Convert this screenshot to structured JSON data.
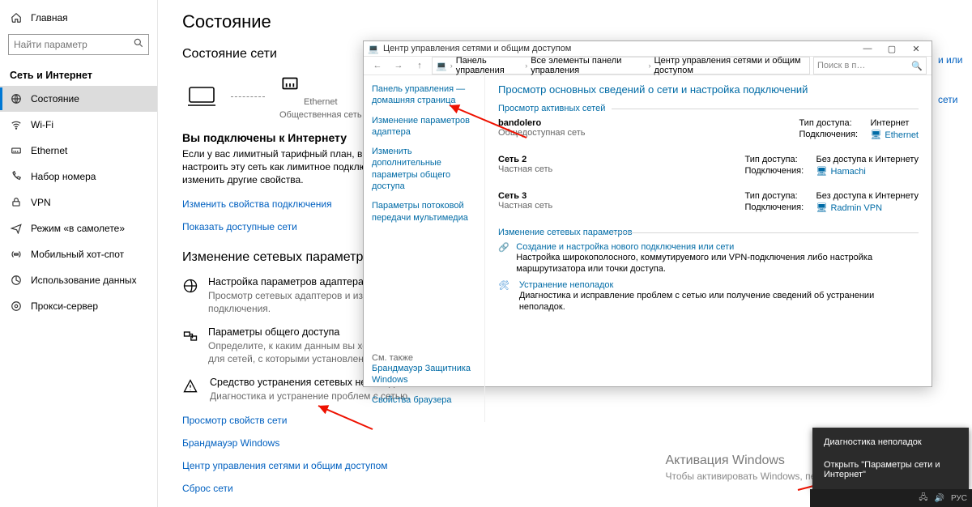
{
  "sidebar": {
    "home": "Главная",
    "search_placeholder": "Найти параметр",
    "group": "Сеть и Интернет",
    "items": [
      {
        "label": "Состояние"
      },
      {
        "label": "Wi-Fi"
      },
      {
        "label": "Ethernet"
      },
      {
        "label": "Набор номера"
      },
      {
        "label": "VPN"
      },
      {
        "label": "Режим «в самолете»"
      },
      {
        "label": "Мобильный хот-спот"
      },
      {
        "label": "Использование данных"
      },
      {
        "label": "Прокси-сервер"
      }
    ]
  },
  "content": {
    "title": "Состояние",
    "status_header": "Состояние сети",
    "diagram": {
      "adapter": "Ethernet",
      "network": "Общественная сеть"
    },
    "connected_title": "Вы подключены к Интернету",
    "connected_desc": "Если у вас лимитный тарифный план, вы можете настроить эту сеть как лимитное подключение или изменить другие свойства.",
    "link_change_props": "Изменить свойства подключения",
    "link_show_nets": "Показать доступные сети",
    "change_header": "Изменение сетевых параметров",
    "opts": [
      {
        "title": "Настройка параметров адаптера",
        "sub": "Просмотр сетевых адаптеров и изменение параметров подключения."
      },
      {
        "title": "Параметры общего доступа",
        "sub": "Определите, к каким данным вы хотите предоставить доступ для сетей, с которыми установлено соединение."
      },
      {
        "title": "Средство устранения сетевых неполадок",
        "sub": "Диагностика и устранение проблем с сетью."
      }
    ],
    "links_after": [
      "Просмотр свойств сети",
      "Брандмауэр Windows",
      "Центр управления сетями и общим доступом",
      "Сброс сети"
    ],
    "cut_links": {
      "a": "и или",
      "b": "сети"
    }
  },
  "cp": {
    "title": "Центр управления сетями и общим доступом",
    "breadcrumb": [
      "Панель управления",
      "Все элементы панели управления",
      "Центр управления сетями и общим доступом"
    ],
    "search_placeholder": "Поиск в п…",
    "left": [
      "Панель управления — домашняя страница",
      "Изменение параметров адаптера",
      "Изменить дополнительные параметры общего доступа",
      "Параметры потоковой передачи мультимедиа"
    ],
    "see_also": "См. также",
    "see_links": [
      "Брандмауэр Защитника Windows",
      "Свойства браузера"
    ],
    "main_title": "Просмотр основных сведений о сети и настройка подключений",
    "active_label": "Просмотр активных сетей",
    "nets": [
      {
        "name": "bandolero",
        "type": "Общедоступная сеть",
        "access": "Интернет",
        "conn": "Ethernet",
        "internet": true
      },
      {
        "name": "Сеть 2",
        "type": "Частная сеть",
        "access": "Без доступа к Интернету",
        "conn": "Hamachi",
        "internet": false
      },
      {
        "name": "Сеть 3",
        "type": "Частная сеть",
        "access": "Без доступа к Интернету",
        "conn": "Radmin VPN",
        "internet": false
      }
    ],
    "k_access": "Тип доступа:",
    "k_conn": "Подключения:",
    "change_label": "Изменение сетевых параметров",
    "change_items": [
      {
        "title": "Создание и настройка нового подключения или сети",
        "sub": "Настройка широкополосного, коммутируемого или VPN-подключения либо настройка маршрутизатора или точки доступа."
      },
      {
        "title": "Устранение неполадок",
        "sub": "Диагностика и исправление проблем с сетью или получение сведений об устранении неполадок."
      }
    ]
  },
  "ctx": {
    "items": [
      "Диагностика неполадок",
      "Открыть \"Параметры сети и Интернет\""
    ]
  },
  "watermark": {
    "big": "Активация Windows",
    "small": "Чтобы активировать Windows, перейдите в раздел \"Параметры\"."
  }
}
